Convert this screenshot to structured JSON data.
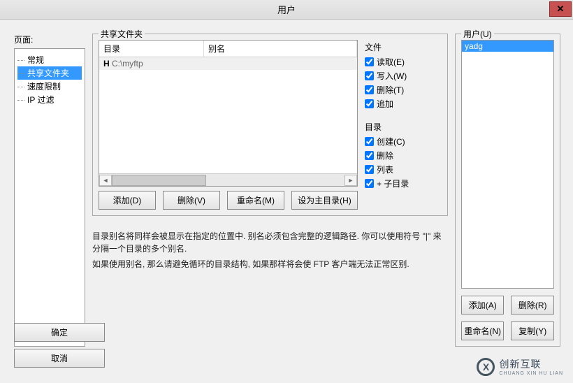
{
  "window": {
    "title": "用户"
  },
  "left": {
    "label": "页面:",
    "items": [
      {
        "label": "常规",
        "selected": false
      },
      {
        "label": "共享文件夹",
        "selected": true
      },
      {
        "label": "速度限制",
        "selected": false
      },
      {
        "label": "IP 过滤",
        "selected": false
      }
    ]
  },
  "share": {
    "title": "共享文件夹",
    "col_dir": "目录",
    "col_alias": "别名",
    "entry_prefix": "H",
    "entry_path": "C:\\myftp",
    "perms_file": {
      "title": "文件",
      "read": "读取(E)",
      "write": "写入(W)",
      "delete": "删除(T)",
      "append": "追加"
    },
    "perms_dir": {
      "title": "目录",
      "create": "创建(C)",
      "delete": "删除",
      "list": "列表",
      "subdirs": "+ 子目录"
    },
    "btn_add": "添加(D)",
    "btn_del": "删除(V)",
    "btn_rename": "重命名(M)",
    "btn_sethome": "设为主目录(H)",
    "desc1": "目录别名将同样会被显示在指定的位置中. 别名必须包含完整的逻辑路径. 你可以使用符号 \"|\" 来分隔一个目录的多个别名.",
    "desc2": "如果使用别名, 那么请避免循环的目录结构, 如果那样将会使 FTP 客户端无法正常区别."
  },
  "users": {
    "title": "用户(U)",
    "list": [
      "yadg"
    ],
    "btn_add": "添加(A)",
    "btn_del": "删除(R)",
    "btn_rename": "重命名(N)",
    "btn_copy": "复制(Y)"
  },
  "bottom": {
    "ok": "确定",
    "cancel": "取消"
  },
  "brand": {
    "main": "创新互联",
    "sub": "CHUANG XIN HU LIAN"
  }
}
